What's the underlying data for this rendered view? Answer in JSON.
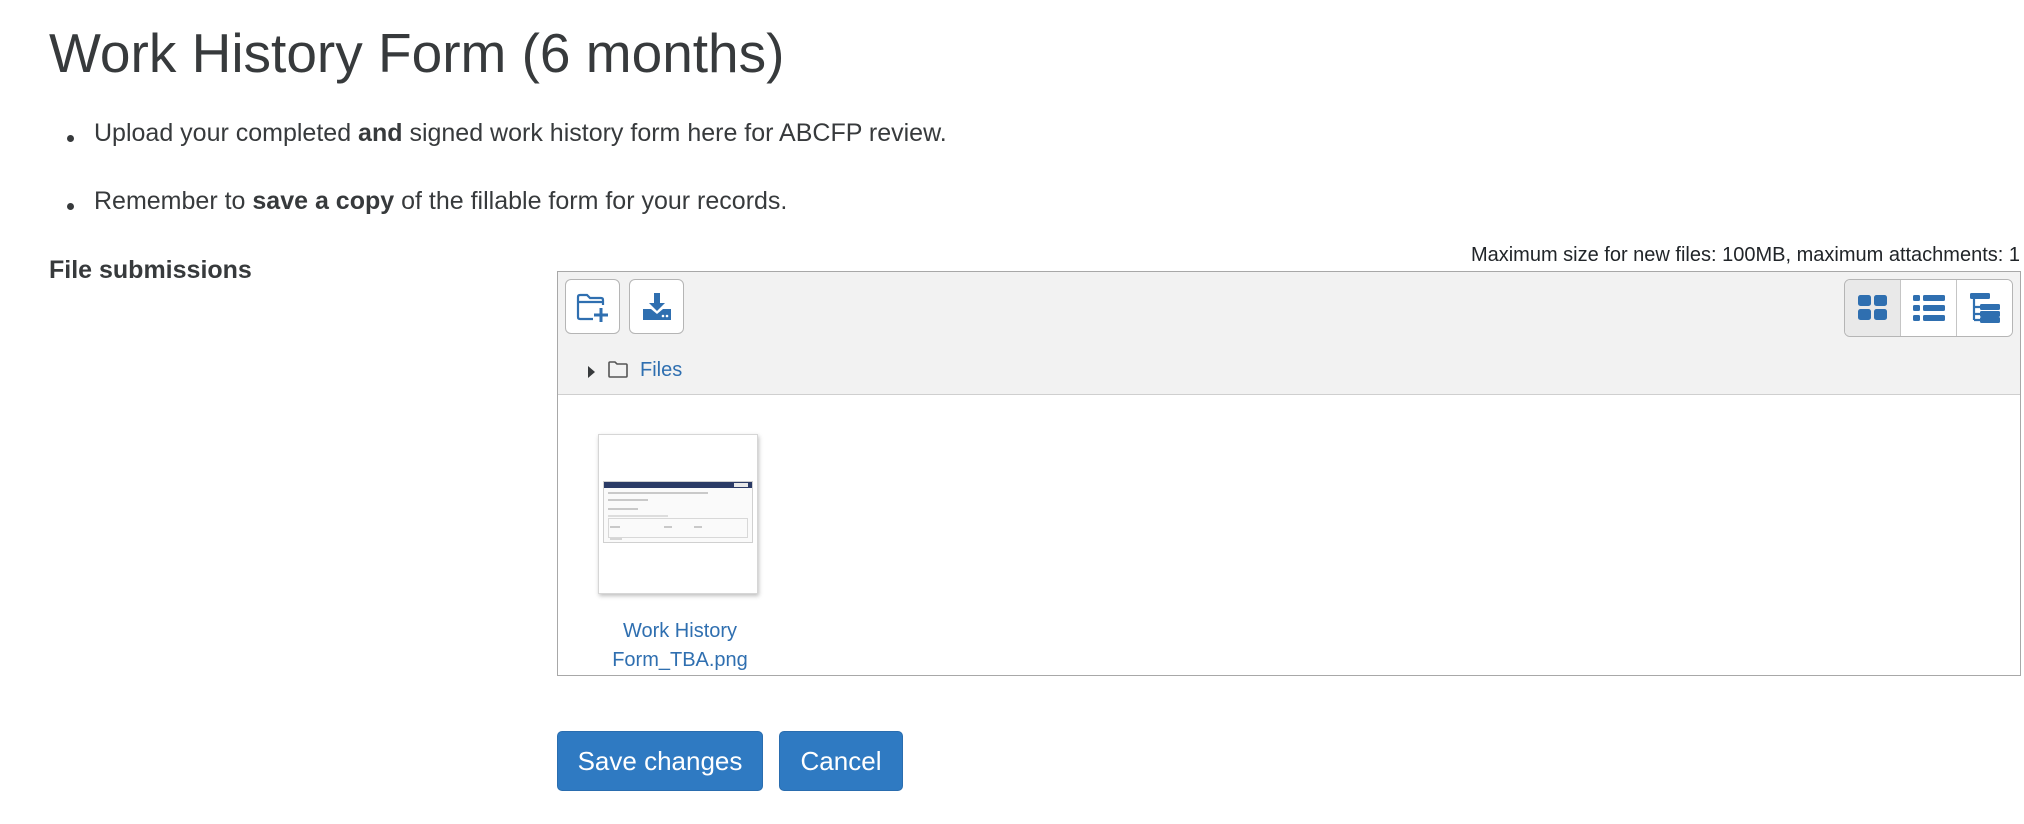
{
  "page": {
    "title": "Work History Form (6 months)"
  },
  "instructions": [
    {
      "pre": "Upload your completed ",
      "bold": "and",
      "post": " signed work history form here for ABCFP review."
    },
    {
      "pre": "Remember to ",
      "bold": "save a copy",
      "post": " of the fillable form for your records."
    }
  ],
  "submission": {
    "label": "File submissions",
    "limits": "Maximum size for new files: 100MB, maximum attachments: 1"
  },
  "filepicker": {
    "toolbar": {
      "add_icon": "folder-plus-icon",
      "download_icon": "download-icon",
      "views": [
        {
          "icon": "grid-view-icon",
          "active": true
        },
        {
          "icon": "list-view-icon",
          "active": false
        },
        {
          "icon": "tree-view-icon",
          "active": false
        }
      ]
    },
    "path": {
      "label": "Files"
    },
    "files": [
      {
        "name": "Work History Form_TBA.png"
      }
    ]
  },
  "actions": {
    "save": "Save changes",
    "cancel": "Cancel"
  },
  "colors": {
    "primary": "#2f7ac2",
    "link": "#2f6fb0",
    "icon": "#2f6fb0",
    "text": "#373a3c"
  }
}
